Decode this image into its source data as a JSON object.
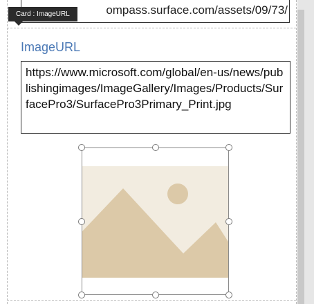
{
  "tooltip": {
    "text": "Card : ImageURL"
  },
  "previous_card": {
    "input_value": "ompass.surface.com/assets/09/73/"
  },
  "image_card": {
    "label": "ImageURL",
    "input_value": "https://www.microsoft.com/global/en-us/news/publishingimages/ImageGallery/Images/Products/SurfacePro3/SurfacePro3Primary_Print.jpg",
    "image_alt": "image-placeholder"
  },
  "colors": {
    "label_accent": "#4a78b5",
    "placeholder_background": "#f2ece0",
    "placeholder_shapes": "#dcc9a8"
  }
}
